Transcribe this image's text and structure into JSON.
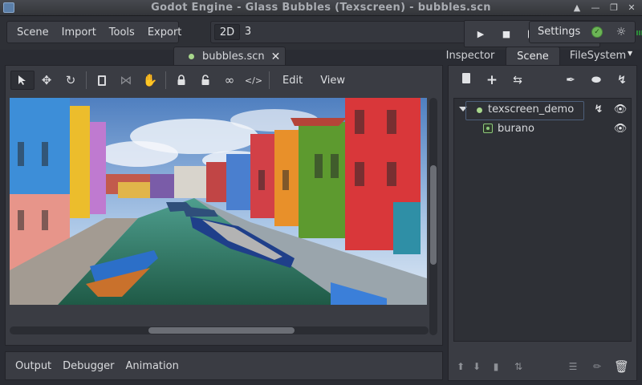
{
  "window": {
    "title": "Godot Engine - Glass Bubbles (Texscreen) - bubbles.scn"
  },
  "menu": {
    "items": [
      "Scene",
      "Import",
      "Tools",
      "Export"
    ]
  },
  "view_modes": {
    "mode_2d": "2D",
    "mode_3d_partial": "3"
  },
  "playback": {
    "icons": [
      "play-icon",
      "stop-icon",
      "play-scene-icon",
      "open-scene-icon",
      "remote-debug-icon"
    ]
  },
  "settings": {
    "label": "Settings"
  },
  "editor": {
    "tab_label": "bubbles.scn",
    "menu_items": [
      "Edit",
      "View"
    ],
    "tools": [
      "select-tool-icon",
      "move-tool-icon",
      "rotate-tool-icon",
      "scale-tool-icon",
      "pivot-tool-icon",
      "pan-tool-icon",
      "lock-icon",
      "unlock-icon",
      "group-icon",
      "ungroup-icon"
    ]
  },
  "bottom_panel": {
    "items": [
      "Output",
      "Debugger",
      "Animation"
    ]
  },
  "right_tabs": [
    "Inspector",
    "Scene",
    "FileSystem"
  ],
  "scene_tree": {
    "root": "texscreen_demo",
    "child": "burano"
  },
  "colors": {
    "accent": "#4d5f7a",
    "scene_dot": "#a8d78c",
    "meter_green": "#2d8a3a",
    "meter_red": "#b23a35",
    "status_ok": "#6cb556"
  }
}
